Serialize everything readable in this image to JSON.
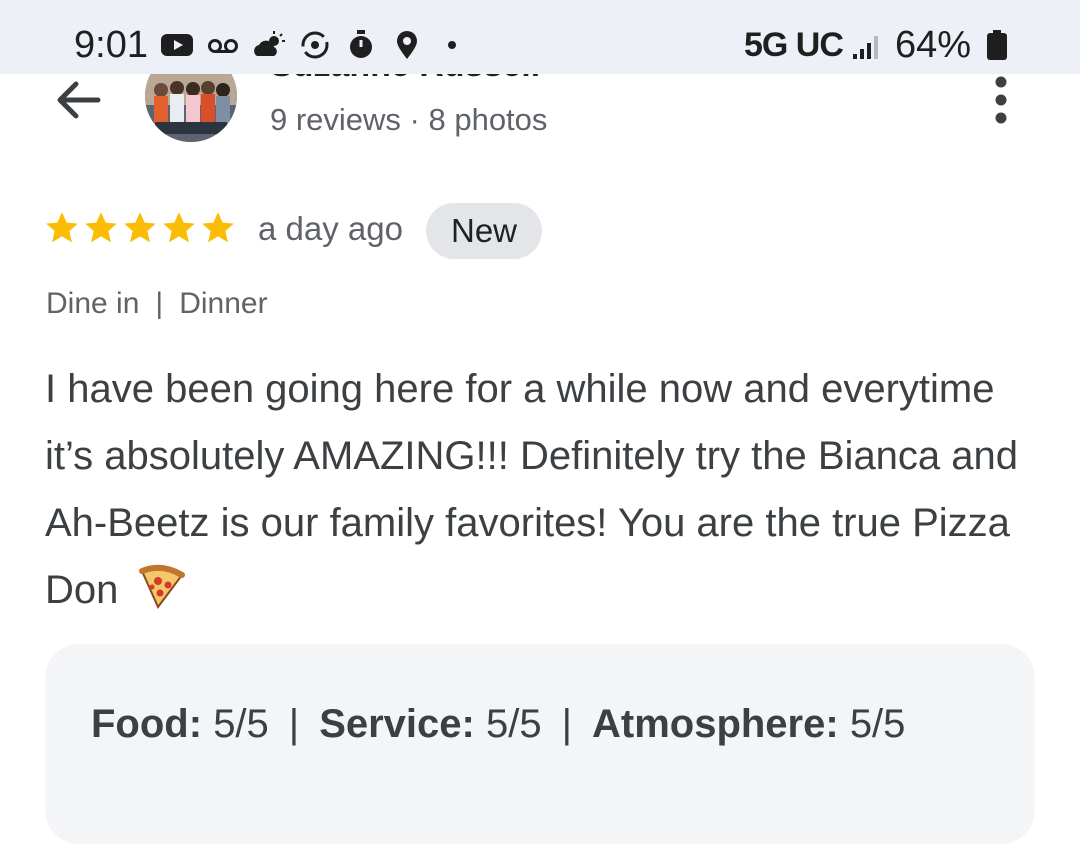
{
  "status_bar": {
    "time": "9:01",
    "network": "5G UC",
    "battery": "64%",
    "icons": [
      "youtube-icon",
      "voicemail-icon",
      "weather-icon",
      "sync-icon",
      "timer-icon",
      "location-icon",
      "dot-icon",
      "signal-icon",
      "battery-icon"
    ]
  },
  "header": {
    "reviewer_name": "Suzanne Russell",
    "reviewer_meta": "9 reviews · 8 photos"
  },
  "review": {
    "rating": 5,
    "rating_max": 5,
    "time_ago": "a day ago",
    "badge": "New",
    "service_type": "Dine in",
    "meal_type": "Dinner",
    "text": "I have been going here for a while now and everytime it’s absolutely AMAZING!!! Definitely try the Bianca and Ah-Beetz is our family favorites! You are the true Pizza Don"
  },
  "ratings": {
    "food_label": "Food:",
    "food_value": "5/5",
    "service_label": "Service:",
    "service_value": "5/5",
    "atmosphere_label": "Atmosphere:",
    "atmosphere_value": "5/5"
  },
  "colors": {
    "star": "#fbbc04",
    "badge_bg": "#e3e5e8",
    "card_bg": "#f4f5f7",
    "status_bar_bg": "#eef0f8"
  }
}
